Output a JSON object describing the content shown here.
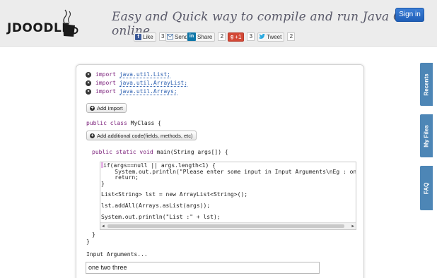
{
  "header": {
    "logo_text": "JDOODLE",
    "tagline": "Easy and Quick way to compile and run Java Code online",
    "signin_label": "Sign in",
    "social": [
      {
        "id": "facebook",
        "label": "Like",
        "count": "3",
        "color": "#3b5998",
        "icon": "f"
      },
      {
        "id": "email",
        "label": "Send",
        "count": "",
        "color": "#6f8fb5",
        "icon": "envelope"
      },
      {
        "id": "linkedin",
        "label": "Share",
        "count": "2",
        "color": "#0e76a8",
        "icon": "in"
      },
      {
        "id": "googleplus",
        "label": "+1",
        "count": "3",
        "color": "#d34836",
        "icon": "g+"
      },
      {
        "id": "twitter",
        "label": "Tweet",
        "count": "2",
        "color": "#2aa9e0",
        "icon": "bird"
      }
    ]
  },
  "sidebar": {
    "tabs": [
      "Recents",
      "My Files",
      "FAQ"
    ]
  },
  "imports": [
    {
      "keyword": "import",
      "package": "java.util.List;"
    },
    {
      "keyword": "import",
      "package": "java.util.ArrayList;"
    },
    {
      "keyword": "import",
      "package": "java.util.Arrays;"
    }
  ],
  "add_import_label": "Add Import",
  "class_decl": {
    "keyword": "public class",
    "name": "MyClass {"
  },
  "add_code_label": "Add additional code(fields, methods, etc)",
  "main_decl": {
    "keyword": "public static void",
    "rest": "main(String args[]) {"
  },
  "editor_lines": [
    "if(args==null || args.length<1) {",
    "    System.out.println(\"Please enter some input in Input Arguments\\nEg : one two three",
    "    return;",
    "}",
    "",
    "List<String> lst = new ArrayList<String>();",
    "",
    "lst.addAll(Arrays.asList(args));",
    "",
    "System.out.println(\"List :\" + lst);"
  ],
  "closing_main": "}",
  "closing_class": "}",
  "input_args_label": "Input Arguments...",
  "input_args_value": "one two three"
}
